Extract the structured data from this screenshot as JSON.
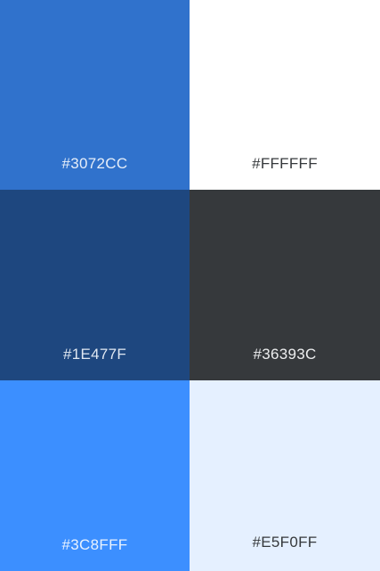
{
  "swatches": [
    {
      "hex": "#3072CC",
      "label": "#3072CC",
      "text_color": "#E6EEF9"
    },
    {
      "hex": "#FFFFFF",
      "label": "#FFFFFF",
      "text_color": "#36393C"
    },
    {
      "hex": "#1E477F",
      "label": "#1E477F",
      "text_color": "#E0E8F2"
    },
    {
      "hex": "#36393C",
      "label": "#36393C",
      "text_color": "#EDEEEF"
    },
    {
      "hex": "#3C8FFF",
      "label": "#3C8FFF",
      "text_color": "#E8F2FF"
    },
    {
      "hex": "#E5F0FF",
      "label": "#E5F0FF",
      "text_color": "#36393C"
    }
  ]
}
